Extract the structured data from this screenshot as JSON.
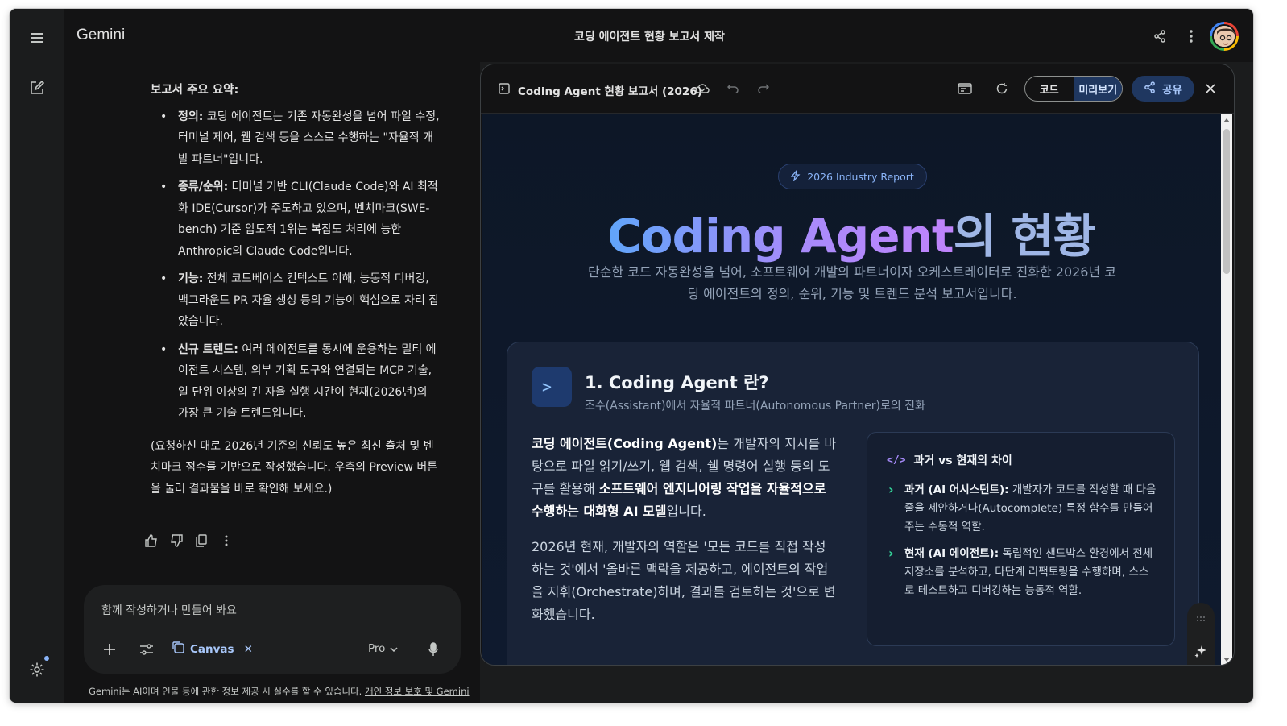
{
  "app": {
    "brand": "Gemini",
    "conversation_title": "코딩 에이전트 현황 보고서 제작"
  },
  "icons": {
    "menu": "menu-icon",
    "new_chat": "edit-icon",
    "settings": "settings-icon",
    "share": "share-icon",
    "more": "more-vert-icon"
  },
  "chat": {
    "heading": "보고서 주요 요약:",
    "bullets": [
      {
        "label": "정의:",
        "text": " 코딩 에이전트는 기존 자동완성을 넘어 파일 수정, 터미널 제어, 웹 검색 등을 스스로 수행하는 \"자율적 개발 파트너\"입니다."
      },
      {
        "label": "종류/순위:",
        "text": " 터미널 기반 CLI(Claude Code)와 AI 최적화 IDE(Cursor)가 주도하고 있으며, 벤치마크(SWE-bench) 기준 압도적 1위는 복잡도 처리에 능한 Anthropic의 Claude Code입니다."
      },
      {
        "label": "기능:",
        "text": " 전체 코드베이스 컨텍스트 이해, 능동적 디버깅, 백그라운드 PR 자율 생성 등의 기능이 핵심으로 자리 잡았습니다."
      },
      {
        "label": "신규 트렌드:",
        "text": " 여러 에이전트를 동시에 운용하는 멀티 에이전트 시스템, 외부 기획 도구와 연결되는 MCP 기술, 일 단위 이상의 긴 자율 실행 시간이 현재(2026년)의 가장 큰 기술 트렌드입니다."
      }
    ],
    "closing": "(요청하신 대로 2026년 기준의 신뢰도 높은 최신 출처 및 벤치마크 점수를 기반으로 작성했습니다. 우측의 Preview 버튼을 눌러 결과물을 바로 확인해 보세요.)"
  },
  "composer": {
    "placeholder": "함께 작성하거나 만들어 봐요",
    "tool_chip": "Canvas",
    "model": "Pro"
  },
  "disclaimer": {
    "text": "Gemini는 AI이며 인물 등에 관한 정보 제공 시 실수를 할 수 있습니다. ",
    "link": "개인 정보 보호 및 Gemini"
  },
  "canvas": {
    "title": "Coding Agent 현황 보고서 (2026)",
    "code_tab": "코드",
    "preview_tab": "미리보기",
    "share_label": "공유"
  },
  "report": {
    "badge": "2026 Industry Report",
    "hero_gradient": "Coding Agent",
    "hero_rest": "의 현황",
    "subtitle": "단순한 코드 자동완성을 넘어, 소프트웨어 개발의 파트너이자 오케스트레이터로 진화한 2026년 코딩 에이전트의 정의, 순위, 기능 및 트렌드 분석 보고서입니다.",
    "section": {
      "icon_text": ">_",
      "title": "1. Coding Agent 란?",
      "subtitle": "조수(Assistant)에서 자율적 파트너(Autonomous Partner)로의 진화",
      "p1_bold1": "코딩 에이전트(Coding Agent)",
      "p1_text1": "는 개발자의 지시를 바탕으로 파일 읽기/쓰기, 웹 검색, 쉘 명령어 실행 등의 도구를 활용해 ",
      "p1_bold2": "소프트웨어 엔지니어링 작업을 자율적으로 수행하는 대화형 AI 모델",
      "p1_text2": "입니다.",
      "p2": "2026년 현재, 개발자의 역할은 '모든 코드를 직접 작성하는 것'에서 '올바른 맥락을 제공하고, 에이전트의 작업을 지휘(Orchestrate)하며, 결과를 검토하는 것'으로 변화했습니다.",
      "compare": {
        "title": "과거 vs 현재의 차이",
        "items": [
          {
            "label": "과거 (AI 어시스턴트):",
            "text": " 개발자가 코드를 작성할 때 다음 줄을 제안하거나(Autocomplete) 특정 함수를 만들어주는 수동적 역할."
          },
          {
            "label": "현재 (AI 에이전트):",
            "text": " 독립적인 샌드박스 환경에서 전체 저장소를 분석하고, 다단계 리팩토링을 수행하며, 스스로 테스트하고 디버깅하는 능동적 역할."
          }
        ]
      }
    }
  }
}
